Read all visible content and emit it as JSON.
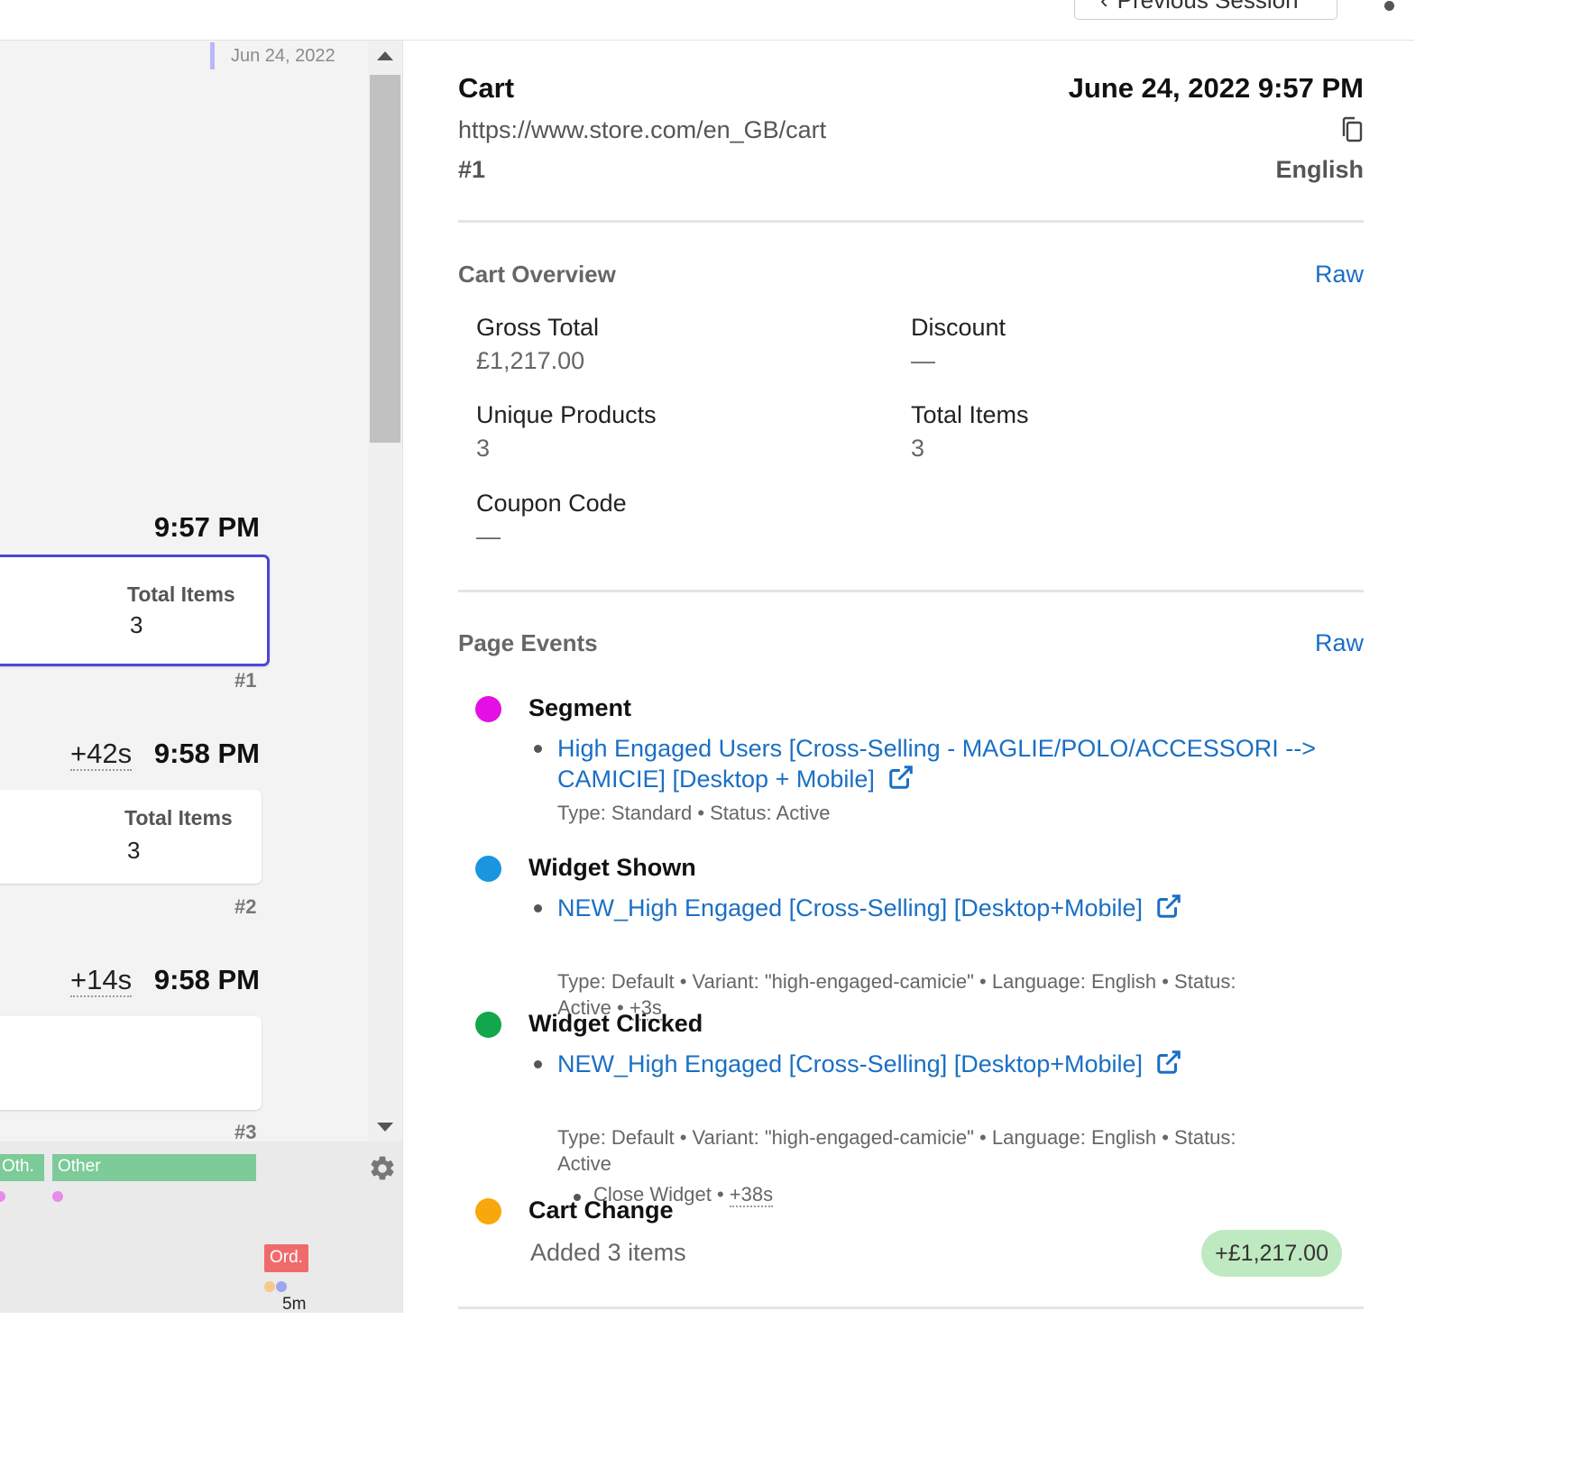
{
  "topbar": {
    "prev_session_label": "Previous Session",
    "prev_chevron": "‹"
  },
  "timeline": {
    "date": "Jun 24, 2022",
    "entries": [
      {
        "delta": "",
        "time": "9:57 PM",
        "card_label": "Total Items",
        "card_value": "3",
        "number": "#1",
        "active": true
      },
      {
        "delta": "+42s",
        "time": "9:58 PM",
        "card_label": "Total Items",
        "card_value": "3",
        "number": "#2",
        "active": false
      },
      {
        "delta": "+14s",
        "time": "9:58 PM",
        "card_label": "",
        "card_value": "",
        "number": "#3",
        "active": false
      }
    ]
  },
  "minimap": {
    "tags": [
      "Oth.",
      "Other"
    ],
    "order_tag": "Ord.",
    "time_label": "5m"
  },
  "detail": {
    "title": "Cart",
    "datetime": "June 24, 2022 9:57 PM",
    "url": "https://www.store.com/en_GB/cart",
    "number": "#1",
    "language": "English",
    "cart_overview": {
      "title": "Cart Overview",
      "raw": "Raw",
      "fields": [
        {
          "label": "Gross Total",
          "value": "£1,217.00"
        },
        {
          "label": "Discount",
          "value": "—"
        },
        {
          "label": "Unique Products",
          "value": "3"
        },
        {
          "label": "Total Items",
          "value": "3"
        },
        {
          "label": "Coupon Code",
          "value": "—"
        }
      ]
    },
    "page_events": {
      "title": "Page Events",
      "raw": "Raw",
      "events": [
        {
          "name": "Segment",
          "color": "#e30fe3",
          "link_line1": "High Engaged Users [Cross-Selling - MAGLIE/POLO/ACCESSORI -->",
          "link_line2": "CAMICIE] [Desktop + Mobile]",
          "meta": "Type: Standard • Status: Active"
        },
        {
          "name": "Widget Shown",
          "color": "#1a95e0",
          "link_line1": "NEW_High Engaged [Cross-Selling] [Desktop+Mobile]",
          "meta_line1": "Type: Default • Variant: \"high-engaged-camicie\" • Language: English • Status:",
          "meta_line2_prefix": "Active • ",
          "meta_line2_delta": "+3s"
        },
        {
          "name": "Widget Clicked",
          "color": "#12a74a",
          "link_line1": "NEW_High Engaged [Cross-Selling] [Desktop+Mobile]",
          "meta_line1": "Type: Default • Variant: \"high-engaged-camicie\" • Language: English • Status:",
          "meta_line2_prefix": "Active",
          "sub_prefix": "Close Widget • ",
          "sub_delta": "+38s"
        },
        {
          "name": "Cart Change",
          "color": "#f8a70c",
          "text": "Added 3 items",
          "amount": "+£1,217.00"
        }
      ]
    }
  },
  "colors": {
    "accent_link": "#1a6fc4",
    "active_card_border": "#4b46d6",
    "minimap_tag": "#7ccb99",
    "order_tag": "#ef6b6b",
    "amount_pill": "#bfe9c0"
  }
}
